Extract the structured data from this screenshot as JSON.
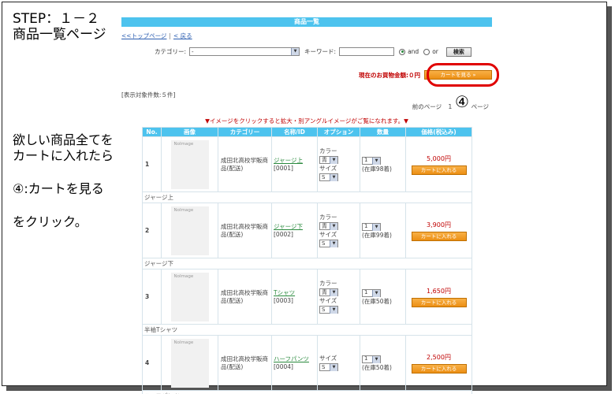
{
  "side": {
    "title_line1": "STEP：１－２",
    "title_line2": "商品一覧ページ",
    "instr_line1": "欲しい商品全てを",
    "instr_line2": "カートに入れたら",
    "instr_line3": "④:カートを見る",
    "instr_line4": "をクリック。"
  },
  "header": {
    "title": "商品一覧"
  },
  "nav": {
    "top": "<<トップページ",
    "sep": "|",
    "back": "< 戻る"
  },
  "search": {
    "category_label": "カテゴリー:",
    "category_value": "-",
    "keyword_label": "キーワード:",
    "keyword_value": "",
    "and_label": "and",
    "or_label": "or",
    "search_button": "検索"
  },
  "cart": {
    "amount_label": "現在のお買物金額:０円",
    "view_button": "カートを見る »",
    "callout_number": "④"
  },
  "results": {
    "count": "[表示対象件数:５件]",
    "pager_prev": "前のページ",
    "pager_page": "1",
    "pager_next": "ページ",
    "notice": "▼イメージをクリックすると拡大・別アングルイメージがご覧になれます。▼"
  },
  "table": {
    "headers": [
      "No.",
      "画像",
      "カテゴリー",
      "名称/ID",
      "オプション",
      "数量",
      "価格(税込み)"
    ],
    "noimage": "NoImage",
    "color_label": "カラー",
    "color_value": "青",
    "size_label": "サイズ",
    "size_value": "S",
    "qty_value": "1",
    "cart_button": "カートに入れる",
    "rows": [
      {
        "no": "1",
        "category": "成田北高校学販商品(配送)",
        "name": "ジャージ上",
        "id": "[0001]",
        "stock": "(在庫98着)",
        "price": "5,000円",
        "subname": "ジャージ上"
      },
      {
        "no": "2",
        "category": "成田北高校学販商品(配送)",
        "name": "ジャージ下",
        "id": "[0002]",
        "stock": "(在庫99着)",
        "price": "3,900円",
        "subname": "ジャージ下"
      },
      {
        "no": "3",
        "category": "成田北高校学販商品(配送)",
        "name": "Tシャツ",
        "id": "[0003]",
        "stock": "(在庫50着)",
        "price": "1,650円",
        "subname": "半袖Tシャツ"
      },
      {
        "no": "4",
        "category": "成田北高校学販商品(配送)",
        "name": "ハーフパンツ",
        "id": "[0004]",
        "stock": "(在庫50着)",
        "price": "2,500円",
        "subname": "ハーフパンツ"
      }
    ]
  }
}
